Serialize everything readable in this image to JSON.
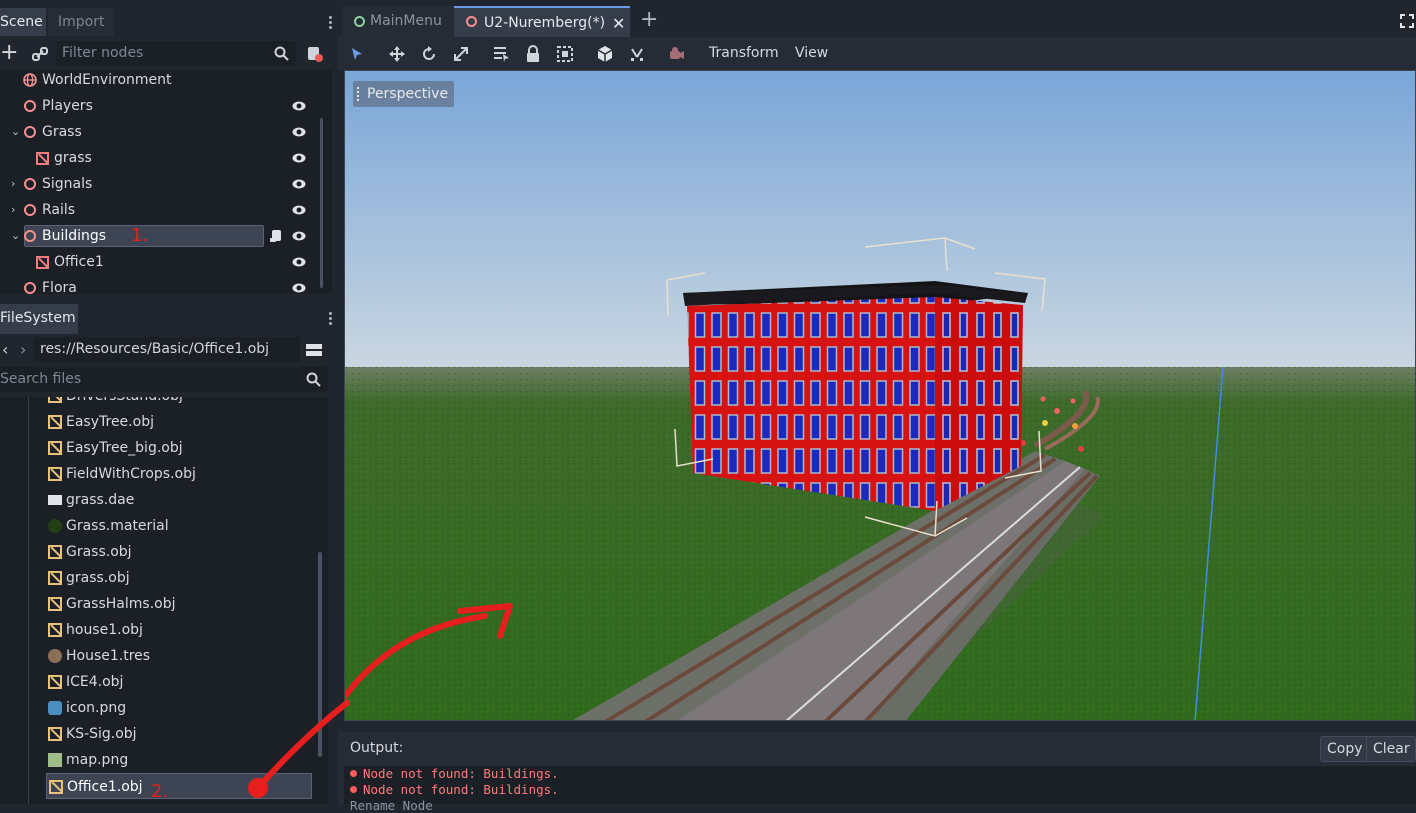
{
  "left_tabs": {
    "scene": "Scene",
    "import": "Import"
  },
  "scene_filter": {
    "placeholder": "Filter nodes"
  },
  "scene_tree": [
    {
      "label": "WorldEnvironment",
      "icon": "world-icon"
    },
    {
      "label": "Players",
      "icon": "node-circle-icon"
    },
    {
      "label": "Grass",
      "icon": "node-circle-icon",
      "expanded": true
    },
    {
      "label": "grass",
      "icon": "mesh-icon"
    },
    {
      "label": "Signals",
      "icon": "node-circle-icon",
      "expanded": false
    },
    {
      "label": "Rails",
      "icon": "node-circle-icon",
      "expanded": false
    },
    {
      "label": "Buildings",
      "icon": "node-circle-icon",
      "expanded": true,
      "selected": true
    },
    {
      "label": "Office1",
      "icon": "mesh-icon"
    },
    {
      "label": "Flora",
      "icon": "node-circle-icon"
    }
  ],
  "filesystem": {
    "tab": "FileSystem",
    "path": "res://Resources/Basic/Office1.obj",
    "search_placeholder": "Search files",
    "files": [
      {
        "name": "DriversStand.obj",
        "icon": "obj"
      },
      {
        "name": "EasyTree.obj",
        "icon": "obj"
      },
      {
        "name": "EasyTree_big.obj",
        "icon": "obj"
      },
      {
        "name": "FieldWithCrops.obj",
        "icon": "obj"
      },
      {
        "name": "grass.dae",
        "icon": "scene"
      },
      {
        "name": "Grass.material",
        "icon": "material"
      },
      {
        "name": "Grass.obj",
        "icon": "obj"
      },
      {
        "name": "grass.obj",
        "icon": "obj"
      },
      {
        "name": "GrassHalms.obj",
        "icon": "obj"
      },
      {
        "name": "house1.obj",
        "icon": "obj"
      },
      {
        "name": "House1.tres",
        "icon": "tres"
      },
      {
        "name": "ICE4.obj",
        "icon": "obj"
      },
      {
        "name": "icon.png",
        "icon": "image"
      },
      {
        "name": "KS-Sig.obj",
        "icon": "obj"
      },
      {
        "name": "map.png",
        "icon": "image"
      },
      {
        "name": "Office1.obj",
        "icon": "obj",
        "selected": true
      }
    ]
  },
  "editor_tabs": [
    {
      "label": "MainMenu",
      "active": false
    },
    {
      "label": "U2-Nuremberg(*)",
      "active": true
    }
  ],
  "toolbar": {
    "transform_menu": "Transform",
    "view_menu": "View"
  },
  "viewport": {
    "perspective_label": "Perspective"
  },
  "output": {
    "label": "Output:",
    "copy": "Copy",
    "clear": "Clear",
    "lines": [
      "Node not found: Buildings.",
      "Node not found: Buildings.",
      "Rename Node"
    ]
  },
  "annotations": {
    "one": "1.",
    "two": "2."
  },
  "colors": {
    "accent": "#699ce8",
    "error": "#ff5d5d",
    "annotation": "#e61e1e"
  }
}
